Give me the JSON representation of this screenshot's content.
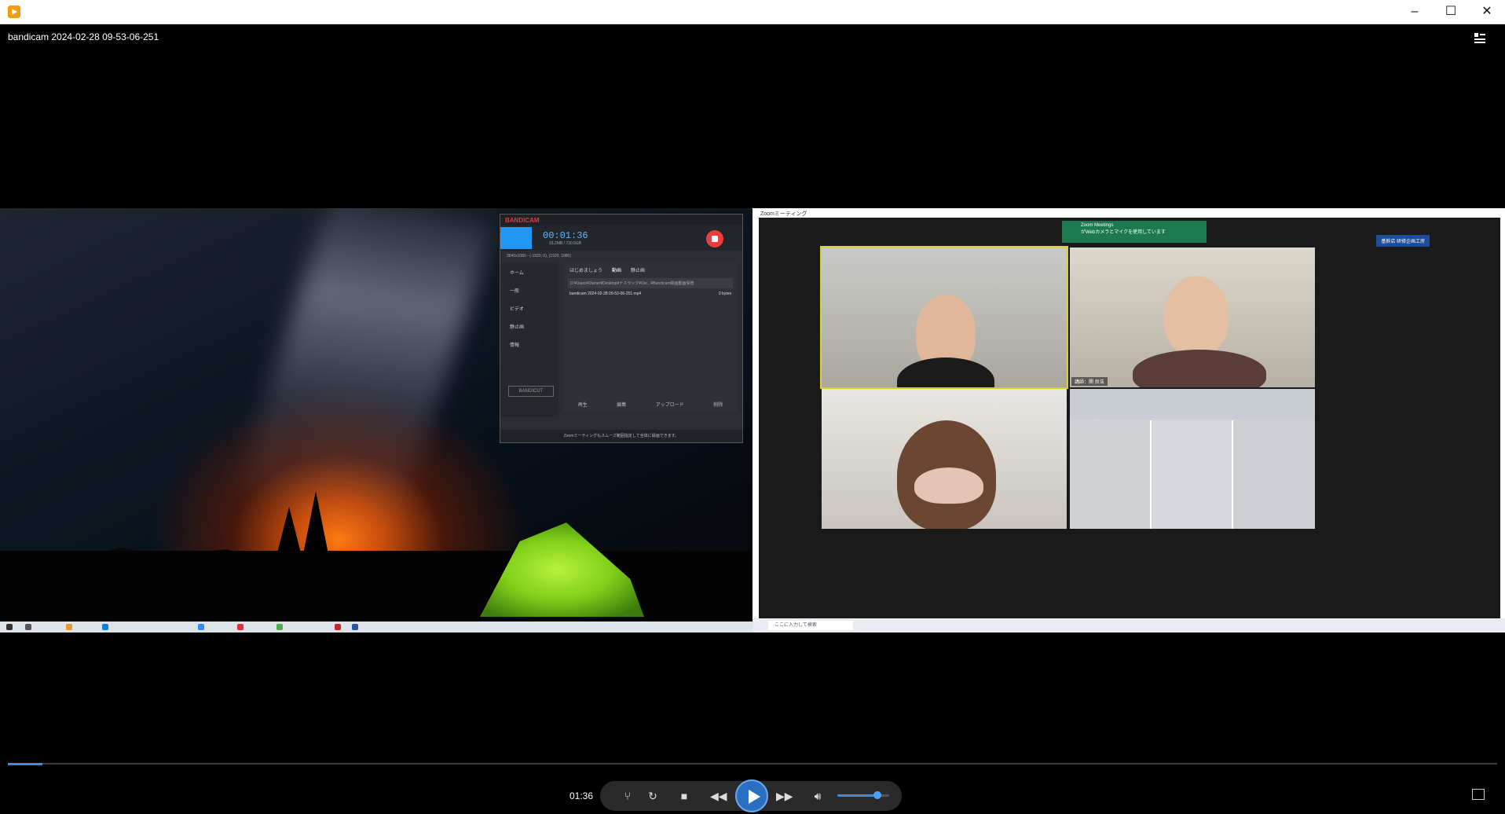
{
  "window": {
    "title": "bandicam 2024-02-28 09-53-06-251",
    "minimize": "–",
    "maximize": "☐",
    "close": "✕"
  },
  "bandicam": {
    "logo_a": "BANDI",
    "logo_b": "CAM",
    "badge": "4.6.0",
    "time": "00:01:36",
    "size": "15.2MB / 730.5GB",
    "area_label": "3840x1080 - (-1920, 0), (1920, 1080)",
    "sidebar": [
      "ホーム",
      "一般",
      "ビデオ",
      "静止画",
      "情報"
    ],
    "tabs": [
      "はじめましょう",
      "動画",
      "静止画"
    ],
    "path": "D:¥Users¥Owner¥Desktop¥ナスラック¥Ow…¥Bandicam録画動画保管",
    "file_name": "bandicam 2024-02-28 09-53-06-251.mp4",
    "file_size": "0 bytes",
    "actions": [
      "再生",
      "編集",
      "アップロード",
      "削除"
    ],
    "bandicut": "BANDICUT",
    "status": "Zoomミーティングもスムーズ範囲指定して全体に録画できます。"
  },
  "zoom": {
    "window_title": "Zoomミーティング",
    "notification_title": "Zoom Meetings",
    "notification_body": "がWebカメラとマイクを使用しています",
    "tag": "基幹店 研修企画工房",
    "speaker_name": "講師：関 良浩",
    "search_placeholder": "ここに入力して検索"
  },
  "player": {
    "time": "01:36",
    "progress_fraction": 0.023,
    "volume_fraction": 0.78
  }
}
